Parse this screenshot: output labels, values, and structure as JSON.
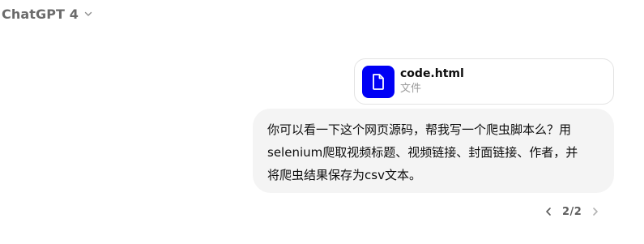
{
  "header": {
    "model_name": "ChatGPT 4",
    "dropdown_icon": "chevron-down-icon"
  },
  "attachment": {
    "file_name": "code.html",
    "file_type": "文件",
    "icon": "document-icon",
    "icon_bg_color": "#0000F5"
  },
  "user_message": {
    "lines": [
      "你可以看一下这个网页源码，帮我写一个爬虫脚本么？用",
      "selenium爬取视频标题、视频链接、封面链接、作者，并",
      "将爬虫结果保存为csv文本。"
    ],
    "bubble_color": "#F4F4F4"
  },
  "pagination": {
    "label": "2/2",
    "prev_icon": "chevron-left-icon",
    "next_icon": "chevron-right-icon"
  }
}
